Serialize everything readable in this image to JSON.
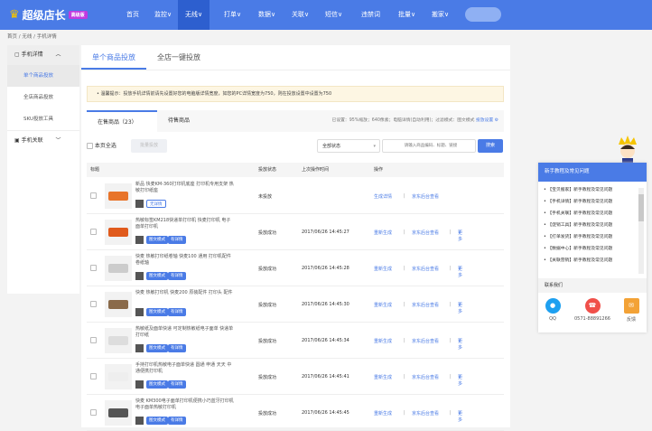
{
  "nav": {
    "brand": "超级店长",
    "badge": "高级版",
    "items": [
      "首页",
      "监控∨",
      "无线∨",
      "打单∨",
      "数据∨",
      "关联∨",
      "短信∨",
      "违禁词",
      "批量∨",
      "搬家∨"
    ],
    "active": 2
  },
  "breadcrumb": [
    "首页",
    "/",
    "无线",
    "/",
    "手机详情"
  ],
  "sidebar": {
    "group1": "手机详情",
    "items": [
      "单个商品投放",
      "全店商品投放",
      "SKU投放工具"
    ],
    "group2": "手机关联"
  },
  "tabs": [
    "单个商品投放",
    "全店一键投放"
  ],
  "notice": "温馨提示：投放手机详情前请先设置好您的电脑版详情宽度，如您的PC详情宽度为750，则在投放设置中设置为750",
  "subtabs": [
    "在售商品（23）",
    "待售商品"
  ],
  "info": {
    "text": "已设置：95%缩放；640像素；电脑详情(自动利用)；过滤模式：图文模式",
    "link": "投放设置"
  },
  "toolbar": {
    "select_all": "本页全选",
    "batch": "批量投放",
    "status": "全部状态",
    "search_placeholder": "请输入商品编码、标题、链接",
    "search": "搜索"
  },
  "table": {
    "headers": [
      "标题",
      "投放状态",
      "上次操作时间",
      "操作"
    ],
    "rows": [
      {
        "title": "新品 快麦KM-360打印机底座 打印机专用支架 热敏打印纸座",
        "tags": [
          "无详情"
        ],
        "status": "未投放",
        "time": "",
        "ops": [
          "生成详情",
          "京东后台查看"
        ],
        "more": ""
      },
      {
        "title": "热敏标签KM218快递单打印机 快麦打印机 电子面单打印机",
        "tags": [
          "图文模式",
          "有详情"
        ],
        "status": "投放成功",
        "time": "2017/06/26 14:45:27",
        "ops": [
          "重新生成",
          "京东后台查看"
        ],
        "more": "更多"
      },
      {
        "title": "快麦 热敏打印纸卷轴 快麦100 通用 打印机配件 卷纸轴",
        "tags": [
          "图文模式",
          "有详情"
        ],
        "status": "投放成功",
        "time": "2017/06/26 14:45:28",
        "ops": [
          "重新生成",
          "京东后台查看"
        ],
        "more": "更多"
      },
      {
        "title": "快麦 热敏打印机 快麦200 原装配件 打印头 配件",
        "tags": [
          "图文模式",
          "有详情"
        ],
        "status": "投放成功",
        "time": "2017/06/26 14:45:30",
        "ops": [
          "重新生成",
          "京东后台查看"
        ],
        "more": "更多"
      },
      {
        "title": "热敏纸及面单快递 可定制热敏纸电子面单 快递单打印纸",
        "tags": [
          "图文模式",
          "有详情"
        ],
        "status": "投放成功",
        "time": "2017/06/26 14:45:34",
        "ops": [
          "重新生成",
          "京东后台查看"
        ],
        "more": "更多"
      },
      {
        "title": "手持打印机热敏电子面单快递 圆通 申通 天天 中通便携打印机",
        "tags": [
          "图文模式",
          "有详情"
        ],
        "status": "投放成功",
        "time": "2017/06/26 14:45:41",
        "ops": [
          "重新生成",
          "京东后台查看"
        ],
        "more": "更多"
      },
      {
        "title": "快麦 KM300电子面单打印机便携小巧蓝牙打印机电子面单热敏打印机",
        "tags": [
          "图文模式",
          "有详情"
        ],
        "status": "投放成功",
        "time": "2017/06/26 14:45:45",
        "ops": [
          "重新生成",
          "京东后台查看"
        ],
        "more": "更多"
      }
    ]
  },
  "help": {
    "title": "新手教程及常见问题",
    "items": [
      "【宝贝搬家】新手教程及常见问题",
      "【手机详情】新手教程及常见问题",
      "【手机关联】新手教程及常见问题",
      "【促销工具】新手教程及常见问题",
      "【打单发货】新手教程及常见问题",
      "【数据中心】新手教程及常见问题",
      "【关联营销】新手教程及常见问题"
    ],
    "contact_title": "联系我们",
    "qq": "QQ",
    "phone": "0571-88891266",
    "feedback": "反馈"
  },
  "colors": {
    "brand": "#4a7be6",
    "qq": "#1ea0f0",
    "phone": "#f0504a",
    "feedback": "#f3a236"
  }
}
